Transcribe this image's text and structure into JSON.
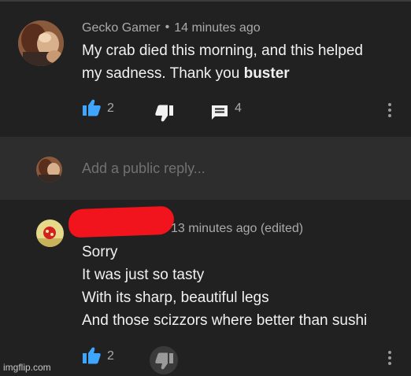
{
  "colors": {
    "background": "#212121",
    "reply_box_background": "#2d2d2d",
    "like_active": "#3ea6ff",
    "redaction": "#f2141c",
    "secondary_text": "#aaaaaa"
  },
  "top_comment": {
    "author": "Gecko Gamer",
    "separator": "•",
    "timestamp": "14 minutes ago",
    "body_line_1_prefix": "My crab died this morning, and this helped",
    "body_line_2_prefix": "my sadness. Thank you ",
    "body_line_2_bold": "buster",
    "like_count": "2",
    "reply_count": "4",
    "icons": [
      "thumbs-up-icon",
      "thumbs-down-icon",
      "comment-icon",
      "more-vert-icon"
    ]
  },
  "reply_box": {
    "placeholder": "Add a public reply..."
  },
  "reply_comment": {
    "timestamp": "13 minutes ago (edited)",
    "lines": [
      "Sorry",
      "It was just so tasty",
      "With its sharp, beautiful legs",
      "And those scizzors where better than sushi"
    ],
    "like_count": "2",
    "icons": [
      "thumbs-up-icon",
      "thumbs-down-icon",
      "more-vert-icon"
    ]
  },
  "watermark": "imgflip.com"
}
